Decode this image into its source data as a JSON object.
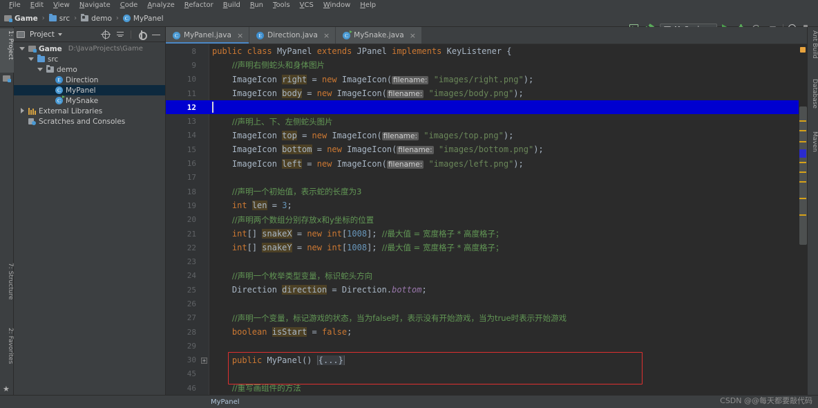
{
  "menu": {
    "items": [
      "File",
      "Edit",
      "View",
      "Navigate",
      "Code",
      "Analyze",
      "Refactor",
      "Build",
      "Run",
      "Tools",
      "VCS",
      "Window",
      "Help"
    ]
  },
  "breadcrumb": {
    "items": [
      {
        "label": "Game",
        "icon": "module-icon"
      },
      {
        "label": "src",
        "icon": "folder-icon"
      },
      {
        "label": "demo",
        "icon": "package-icon"
      },
      {
        "label": "MyPanel",
        "icon": "class-icon"
      }
    ],
    "separator": "›"
  },
  "toolbar": {
    "run_config_name": "MySnake",
    "icons": [
      "project-structure-icon",
      "build-hammer-icon",
      "run-icon",
      "debug-icon",
      "coverage-icon",
      "stop-icon",
      "search-everywhere-icon",
      "project-settings-icon"
    ]
  },
  "left_strip": {
    "project_tab": "1: Project",
    "structure_tab": "7: Structure",
    "favorites_tab": "2: Favorites"
  },
  "project_panel": {
    "title": "Project",
    "tools": [
      "locate-icon",
      "collapse-all-icon",
      "settings-gear-icon",
      "hide-icon"
    ],
    "tree": [
      {
        "label": "Game",
        "detail": "D:\\JavaProjects\\Game",
        "indent": 0,
        "twisty": "down",
        "icon": "module-icon",
        "bold": true,
        "selected": false
      },
      {
        "label": "src",
        "detail": "",
        "indent": 1,
        "twisty": "down",
        "icon": "folder-icon",
        "bold": false,
        "selected": false
      },
      {
        "label": "demo",
        "detail": "",
        "indent": 2,
        "twisty": "down",
        "icon": "package-icon",
        "bold": false,
        "selected": false
      },
      {
        "label": "Direction",
        "detail": "",
        "indent": 3,
        "twisty": "none",
        "icon": "enum-icon",
        "bold": false,
        "selected": false
      },
      {
        "label": "MyPanel",
        "detail": "",
        "indent": 3,
        "twisty": "none",
        "icon": "class-icon",
        "bold": false,
        "selected": true
      },
      {
        "label": "MySnake",
        "detail": "",
        "indent": 3,
        "twisty": "none",
        "icon": "runnable-class-icon",
        "bold": false,
        "selected": false
      },
      {
        "label": "External Libraries",
        "detail": "",
        "indent": 0,
        "twisty": "right",
        "icon": "library-icon",
        "bold": false,
        "selected": false
      },
      {
        "label": "Scratches and Consoles",
        "detail": "",
        "indent": 0,
        "twisty": "none",
        "icon": "scratch-icon",
        "bold": false,
        "selected": false
      }
    ]
  },
  "editor": {
    "tabs": [
      {
        "label": "MyPanel.java",
        "icon": "class-icon",
        "active": true
      },
      {
        "label": "Direction.java",
        "icon": "enum-icon",
        "active": false
      },
      {
        "label": "MySnake.java",
        "icon": "runnable-class-icon",
        "active": false
      }
    ],
    "close_glyph": "×",
    "current_line": 12,
    "fold_marker": "+",
    "lines": [
      {
        "num": "8",
        "html": "<span class=\"kw\">public</span> <span class=\"kw\">class</span> MyPanel <span class=\"kw\">extends</span> JPanel <span class=\"kw\">implements</span> KeyListener {"
      },
      {
        "num": "9",
        "html": "    <span class=\"cmt-cn cn\">//声明右侧蛇头和身体图片</span>"
      },
      {
        "num": "10",
        "html": "    ImageIcon <span class=\"hl-ident\">right</span> = <span class=\"kw\">new</span> ImageIcon(<span class=\"param-hint\">filename:</span> <span class=\"str\">\"images/right.png\"</span>);"
      },
      {
        "num": "11",
        "html": "    ImageIcon <span class=\"hl-ident\">body</span> = <span class=\"kw\">new</span> ImageIcon(<span class=\"param-hint\">filename:</span> <span class=\"str\">\"images/body.png\"</span>);"
      },
      {
        "num": "12",
        "html": ""
      },
      {
        "num": "13",
        "html": "    <span class=\"cmt-cn cn\">//声明上、下、左侧蛇头图片</span>"
      },
      {
        "num": "14",
        "html": "    ImageIcon <span class=\"hl-ident\">top</span> = <span class=\"kw\">new</span> ImageIcon(<span class=\"param-hint\">filename:</span> <span class=\"str\">\"images/top.png\"</span>);"
      },
      {
        "num": "15",
        "html": "    ImageIcon <span class=\"hl-ident\">bottom</span> = <span class=\"kw\">new</span> ImageIcon(<span class=\"param-hint\">filename:</span> <span class=\"str\">\"images/bottom.png\"</span>);"
      },
      {
        "num": "16",
        "html": "    ImageIcon <span class=\"hl-ident\">left</span> = <span class=\"kw\">new</span> ImageIcon(<span class=\"param-hint\">filename:</span> <span class=\"str\">\"images/left.png\"</span>);"
      },
      {
        "num": "17",
        "html": ""
      },
      {
        "num": "18",
        "html": "    <span class=\"cmt-cn cn\">//声明一个初始值，表示蛇的长度为3</span>"
      },
      {
        "num": "19",
        "html": "    <span class=\"kw\">int</span> <span class=\"hl-ident\">len</span> = <span class=\"num\">3</span>;"
      },
      {
        "num": "20",
        "html": "    <span class=\"cmt-cn cn\">//声明两个数组分别存放x和y坐标的位置</span>"
      },
      {
        "num": "21",
        "html": "    <span class=\"kw\">int</span>[] <span class=\"hl-ident\">snakeX</span> = <span class=\"kw\">new</span> <span class=\"kw\">int</span>[<span class=\"num\">1008</span>]; <span class=\"cmt-cn cn\">//最大值 = 宽度格子 * 高度格子；</span>"
      },
      {
        "num": "22",
        "html": "    <span class=\"kw\">int</span>[] <span class=\"hl-ident\">snakeY</span> = <span class=\"kw\">new</span> <span class=\"kw\">int</span>[<span class=\"num\">1008</span>]; <span class=\"cmt-cn cn\">//最大值 = 宽度格子 * 高度格子；</span>"
      },
      {
        "num": "23",
        "html": ""
      },
      {
        "num": "24",
        "html": "    <span class=\"cmt-cn cn\">//声明一个枚举类型变量，标识蛇头方向</span>"
      },
      {
        "num": "25",
        "html": "    Direction <span class=\"hl-ident\">direction</span> = Direction.<span class=\"fld ital\">bottom</span>;"
      },
      {
        "num": "26",
        "html": ""
      },
      {
        "num": "27",
        "html": "    <span class=\"cmt-cn cn\">//声明一个变量，标记游戏的状态，当为false时，表示没有开始游戏，当为true时表示开始游戏</span>"
      },
      {
        "num": "28",
        "html": "    <span class=\"kw\">boolean</span> <span class=\"hl-ident\">isStart</span> = <span class=\"kw\">false</span>;"
      },
      {
        "num": "29",
        "html": ""
      },
      {
        "num": "30",
        "html": "    <span class=\"kw\">public</span> MyPanel() <span class=\"fold-inline\">{...}</span>",
        "fold": true
      },
      {
        "num": "45",
        "html": ""
      },
      {
        "num": "46",
        "html": "    <span class=\"cmt-cn cn\">//重写画组件的方法</span>"
      }
    ]
  },
  "right_strip": {
    "ant_build": "Ant Build",
    "database": "Database",
    "maven": "Maven"
  },
  "statusbar": {
    "context": "MyPanel",
    "watermark": "CSDN @@每天都要敲代码"
  },
  "colors": {
    "accent": "#4a88c7",
    "annotation": "#e03030",
    "current_line": "#0000d0",
    "keyword": "#cc7832",
    "string": "#6a8759",
    "comment": "#629755",
    "number": "#6897bb"
  }
}
